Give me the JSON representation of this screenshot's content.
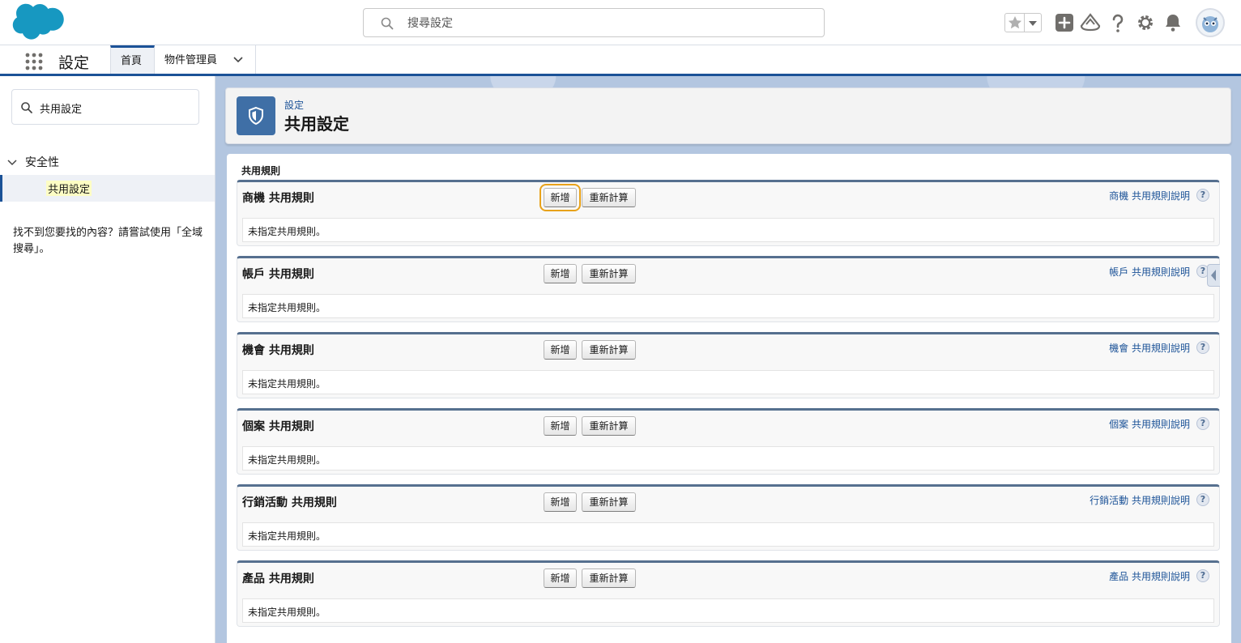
{
  "header": {
    "search_placeholder": "搜尋設定",
    "colors": {
      "brand_cloud": "#1798c1",
      "accent": "#1b5297"
    },
    "icons": [
      "favorites-star-icon",
      "favorites-dropdown-icon",
      "global-add-icon",
      "trailhead-icon",
      "help-icon",
      "setup-gear-icon",
      "notifications-bell-icon",
      "user-avatar"
    ]
  },
  "nav": {
    "app_name": "設定",
    "tabs": [
      {
        "label": "首頁"
      },
      {
        "label": "物件管理員"
      }
    ]
  },
  "sidebar": {
    "search_value": "共用設定",
    "tree_parent": "安全性",
    "tree_child": "共用設定",
    "help_text": "找不到您要找的內容？請嘗試使用「全域搜尋」。"
  },
  "page": {
    "breadcrumb": "設定",
    "title": "共用設定",
    "section_heading": "共用規則"
  },
  "panels": [
    {
      "title": "商機 共用規則",
      "new_label": "新增",
      "recalc_label": "重新計算",
      "help_link": "商機 共用規則說明",
      "empty_text": "未指定共用規則。"
    },
    {
      "title": "帳戶 共用規則",
      "new_label": "新增",
      "recalc_label": "重新計算",
      "help_link": "帳戶 共用規則說明",
      "empty_text": "未指定共用規則。"
    },
    {
      "title": "機會 共用規則",
      "new_label": "新增",
      "recalc_label": "重新計算",
      "help_link": "機會 共用規則說明",
      "empty_text": "未指定共用規則。"
    },
    {
      "title": "個案 共用規則",
      "new_label": "新增",
      "recalc_label": "重新計算",
      "help_link": "個案 共用規則說明",
      "empty_text": "未指定共用規則。"
    },
    {
      "title": "行銷活動 共用規則",
      "new_label": "新增",
      "recalc_label": "重新計算",
      "help_link": "行銷活動 共用規則說明",
      "empty_text": "未指定共用規則。"
    },
    {
      "title": "產品 共用規則",
      "new_label": "新增",
      "recalc_label": "重新計算",
      "help_link": "產品 共用規則說明",
      "empty_text": "未指定共用規則。"
    }
  ],
  "help_glyph": "?"
}
